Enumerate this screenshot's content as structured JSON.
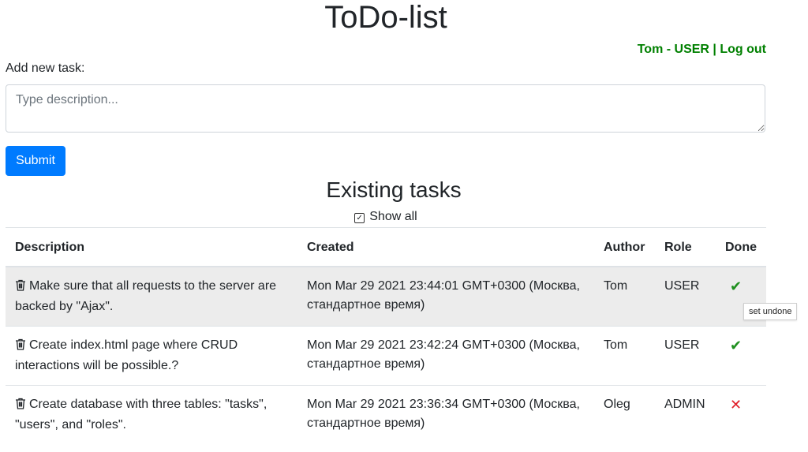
{
  "header": {
    "title": "ToDo-list"
  },
  "user": {
    "name": "Tom",
    "separator": " - ",
    "role": "USER",
    "divider": " | ",
    "logout": "Log out"
  },
  "form": {
    "label": "Add new task:",
    "placeholder": "Type description...",
    "submit_label": "Submit"
  },
  "tasks": {
    "title": "Existing tasks",
    "show_all_label": "Show all",
    "show_all_checked": true,
    "columns": [
      "Description",
      "Created",
      "Author",
      "Role",
      "Done"
    ],
    "rows": [
      {
        "description": "Make sure that all requests to the server are backed by \"Ajax\".",
        "created": "Mon Mar 29 2021 23:44:01 GMT+0300 (Москва, стандартное время)",
        "author": "Tom",
        "role": "USER",
        "done": "check-icon"
      },
      {
        "description": "Create index.html page where CRUD interactions will be possible.?",
        "created": "Mon Mar 29 2021 23:42:24 GMT+0300 (Москва, стандартное время)",
        "author": "Tom",
        "role": "USER",
        "done": "check-icon"
      },
      {
        "description": "Create database with three tables: \"tasks\", \"users\", and \"roles\".",
        "created": "Mon Mar 29 2021 23:36:34 GMT+0300 (Москва, стандартное время)",
        "author": "Oleg",
        "role": "ADMIN",
        "done": "cross-icon"
      }
    ]
  },
  "tooltip": {
    "text": "set undone"
  },
  "colors": {
    "accent": "#007bff",
    "user_link": "#008000",
    "done_check": "#1e8f1e",
    "done_cross": "#e0202b",
    "row_highlight": "#ececec"
  }
}
